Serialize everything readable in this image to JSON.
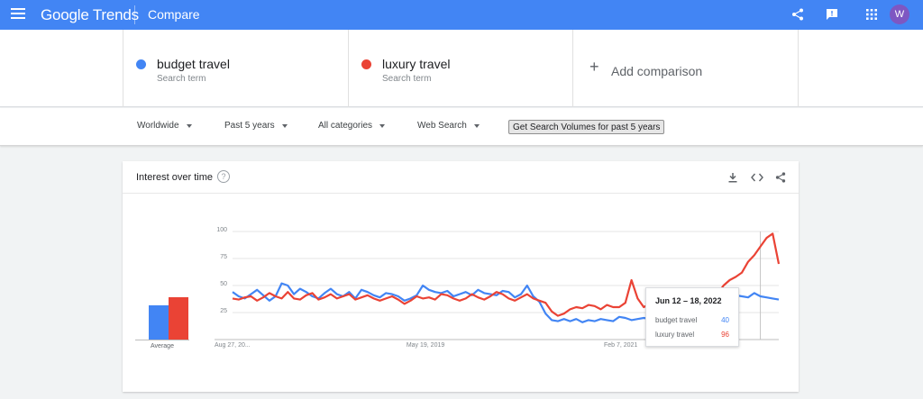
{
  "header": {
    "app_name": "Google Trends",
    "page_title": "Compare",
    "avatar_initial": "W",
    "icons": [
      "menu-icon",
      "share-icon",
      "feedback-icon",
      "apps-icon"
    ],
    "bar_color": "#4285f4"
  },
  "terms": [
    {
      "name": "budget travel",
      "type": "Search term",
      "color": "#4285f4"
    },
    {
      "name": "luxury travel",
      "type": "Search term",
      "color": "#ea4335"
    }
  ],
  "add_comparison": {
    "label": "Add comparison"
  },
  "filters": {
    "region": "Worldwide",
    "time_range": "Past 5 years",
    "category": "All categories",
    "search_type": "Web Search",
    "volume_button": "Get Search Volumes for past 5 years"
  },
  "card": {
    "title": "Interest over time",
    "icons": [
      "help-icon",
      "download-icon",
      "embed-icon",
      "share-icon"
    ]
  },
  "average": {
    "label": "Average",
    "budget_travel": 32,
    "luxury_travel": 39
  },
  "tooltip": {
    "date": "Jun 12 – 18, 2022",
    "rows": [
      {
        "term": "budget travel",
        "value": "40"
      },
      {
        "term": "luxury travel",
        "value": "96"
      }
    ]
  },
  "chart_data": {
    "type": "line",
    "x_tick_labels": [
      "Aug 27, 20...",
      "May 19, 2019",
      "Feb 7, 2021"
    ],
    "y_tick_labels": [
      "100",
      "75",
      "50",
      "25"
    ],
    "ylim": [
      0,
      100
    ],
    "grid": true,
    "series": [
      {
        "name": "budget travel",
        "color": "#4285f4",
        "values": [
          44,
          40,
          38,
          42,
          46,
          41,
          36,
          40,
          52,
          50,
          42,
          47,
          44,
          40,
          38,
          43,
          47,
          42,
          40,
          44,
          38,
          46,
          44,
          41,
          39,
          43,
          42,
          40,
          36,
          38,
          41,
          50,
          46,
          44,
          43,
          45,
          40,
          42,
          44,
          41,
          46,
          43,
          42,
          41,
          45,
          44,
          39,
          42,
          50,
          40,
          35,
          24,
          18,
          17,
          19,
          17,
          19,
          16,
          18,
          17,
          19,
          18,
          17,
          21,
          20,
          18,
          19,
          20,
          19,
          21,
          24,
          26,
          22,
          30,
          31,
          33,
          35,
          36,
          38,
          36,
          37,
          40,
          41,
          40,
          39,
          43,
          40,
          39,
          38,
          37
        ]
      },
      {
        "name": "luxury travel",
        "color": "#ea4335",
        "values": [
          38,
          37,
          39,
          40,
          36,
          39,
          43,
          40,
          38,
          44,
          38,
          37,
          41,
          43,
          37,
          39,
          42,
          38,
          40,
          42,
          37,
          39,
          41,
          38,
          36,
          38,
          40,
          37,
          33,
          36,
          40,
          38,
          39,
          37,
          42,
          41,
          38,
          36,
          38,
          42,
          39,
          37,
          40,
          44,
          42,
          38,
          36,
          39,
          42,
          38,
          36,
          34,
          26,
          22,
          24,
          28,
          30,
          29,
          32,
          31,
          28,
          32,
          30,
          30,
          34,
          55,
          38,
          30,
          33,
          31,
          36,
          34,
          31,
          33,
          36,
          32,
          37,
          34,
          38,
          42,
          50,
          55,
          58,
          62,
          72,
          78,
          86,
          94,
          98,
          70
        ]
      }
    ]
  }
}
